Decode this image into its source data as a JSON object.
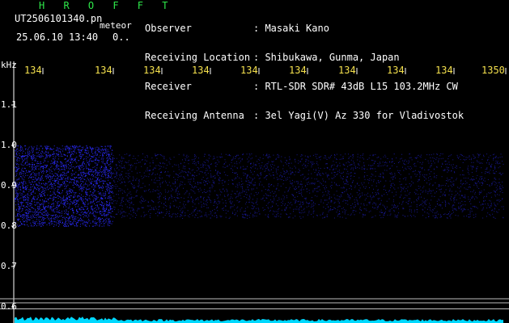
{
  "header": {
    "title": "H R O F F T",
    "filename": "UT2506101340.pn",
    "filename_suffix": "meteor",
    "timestamp": "25.06.10 13:40",
    "count": "0.."
  },
  "info": [
    {
      "label": "Observer",
      "value": ": Masaki Kano"
    },
    {
      "label": "Receiving Location",
      "value": ": Shibukawa, Gunma, Japan"
    },
    {
      "label": "Receiver",
      "value": ": RTL-SDR SDR# 43dB L15 103.2MHz CW"
    },
    {
      "label": "Receiving Antenna",
      "value": ": 3el Yagi(V) Az 330 for Vladivostok"
    }
  ],
  "colors": {
    "signal": "#2a2aff",
    "axis_tick": "#f4e04d",
    "trace": "#00d8ff",
    "guide": "#bdbdbd",
    "title": "#2ee84a"
  },
  "chart_data": {
    "type": "heatmap",
    "y_unit_label": "kHz",
    "x_ticks": [
      "134",
      "134",
      "134",
      "134",
      "134",
      "134",
      "134",
      "134",
      "134",
      "1350"
    ],
    "y_ticks": [
      "1.1",
      "1.0",
      "0.9",
      "0.8",
      "0.7",
      "0.6"
    ],
    "ylim": [
      0.6,
      1.1
    ],
    "bands": [
      {
        "y_range": [
          0.8,
          1.0
        ],
        "density": "high",
        "x_span": [
          0.0,
          0.2
        ]
      },
      {
        "y_range": [
          0.82,
          0.98
        ],
        "density": "low",
        "x_span": [
          0.2,
          1.0
        ]
      }
    ],
    "reference_lines_khz": [
      0.62,
      0.61,
      0.595
    ]
  }
}
